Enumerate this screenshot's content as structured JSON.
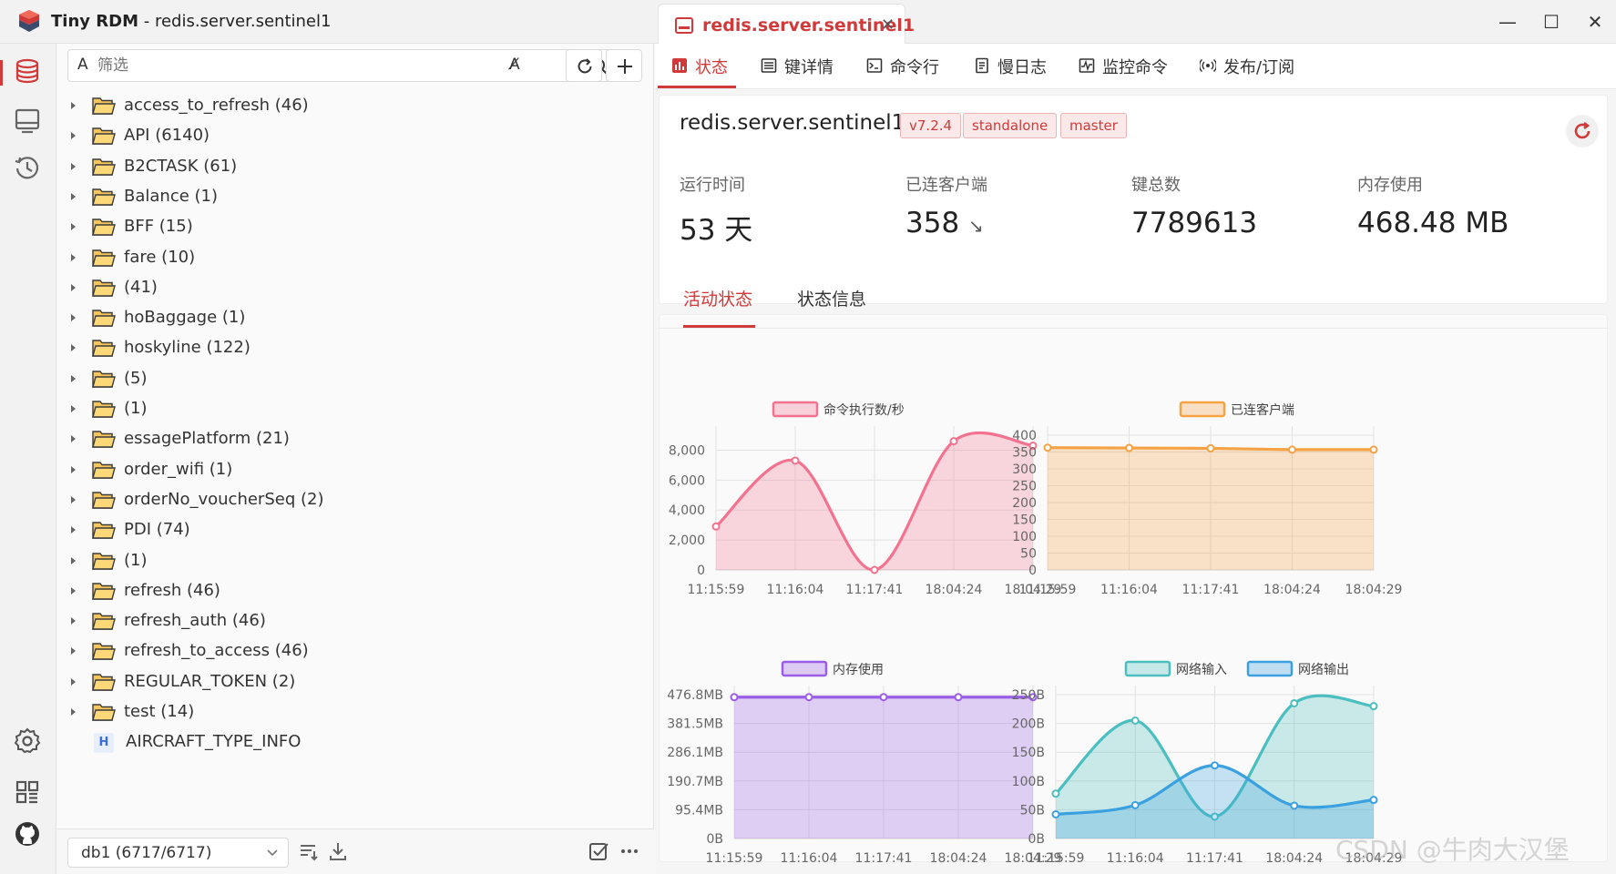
{
  "window": {
    "app_name": "Tiny RDM",
    "title_sep": " - ",
    "connection": "redis.server.sentinel1",
    "tab_label": "redis.server.sentinel1",
    "close_glyph": "✕",
    "minimize_glyph": "—",
    "maximize_glyph": "☐",
    "window_close_glyph": "✕"
  },
  "colors": {
    "accent": "#d03a3a",
    "pink": "#f3728f",
    "orange": "#f5a245",
    "purple": "#9b5de5",
    "teal": "#4bbfbf",
    "blue": "#3aa0e0"
  },
  "rail": {
    "icons": [
      "database-icon",
      "monitor-icon",
      "history-icon",
      "settings-icon",
      "grid-icon",
      "github-icon"
    ]
  },
  "browser": {
    "filter_prefix": "A",
    "filter_placeholder": "筛选",
    "case_icon_glyph": "A̸",
    "tree": [
      {
        "type": "folder",
        "label": "access_to_refresh (46)"
      },
      {
        "type": "folder",
        "label": "API (6140)"
      },
      {
        "type": "folder",
        "label": "B2CTASK (61)"
      },
      {
        "type": "folder",
        "label": "Balance (1)"
      },
      {
        "type": "folder",
        "label": "BFF (15)"
      },
      {
        "type": "folder",
        "label": "fare (10)"
      },
      {
        "type": "folder",
        "label": "(41)"
      },
      {
        "type": "folder",
        "label": "hoBaggage (1)"
      },
      {
        "type": "folder",
        "label": "hoskyline (122)"
      },
      {
        "type": "folder",
        "label": "(5)"
      },
      {
        "type": "folder",
        "label": "(1)"
      },
      {
        "type": "folder",
        "label": "essagePlatform (21)"
      },
      {
        "type": "folder",
        "label": "order_wifi (1)"
      },
      {
        "type": "folder",
        "label": "orderNo_voucherSeq (2)"
      },
      {
        "type": "folder",
        "label": "PDI (74)"
      },
      {
        "type": "folder",
        "label": "(1)"
      },
      {
        "type": "folder",
        "label": "refresh (46)"
      },
      {
        "type": "folder",
        "label": "refresh_auth (46)"
      },
      {
        "type": "folder",
        "label": "refresh_to_access (46)"
      },
      {
        "type": "folder",
        "label": "REGULAR_TOKEN (2)"
      },
      {
        "type": "folder",
        "label": "test (14)"
      },
      {
        "type": "hash",
        "badge": "H",
        "label": "AIRCRAFT_TYPE_INFO"
      }
    ],
    "db_select": "db1 (6717/6717)"
  },
  "server": {
    "tabs": [
      "状态",
      "键详情",
      "命令行",
      "慢日志",
      "监控命令",
      "发布/订阅"
    ],
    "name": "redis.server.sentinel1",
    "tags": [
      "v7.2.4",
      "standalone",
      "master"
    ],
    "stats": [
      {
        "label": "运行时间",
        "value": "53 天"
      },
      {
        "label": "已连客户端",
        "value": "358",
        "trend": "↘"
      },
      {
        "label": "键总数",
        "value": "7789613"
      },
      {
        "label": "内存使用",
        "value": "468.48 MB"
      }
    ],
    "activity_tabs": [
      "活动状态",
      "状态信息"
    ]
  },
  "chart_data": [
    {
      "type": "line",
      "title": "",
      "x": [
        "11:15:59",
        "11:16:04",
        "11:17:41",
        "18:04:24",
        "18:04:29"
      ],
      "series": [
        {
          "name": "命令执行数/秒",
          "values": [
            2900,
            7300,
            0,
            8600,
            8300
          ]
        }
      ],
      "yticks": [
        "0",
        "2,000",
        "4,000",
        "6,000",
        "8,000"
      ],
      "ylim": [
        0,
        9000
      ],
      "fill": true,
      "grid": true,
      "legend": "top-center"
    },
    {
      "type": "line",
      "title": "",
      "x": [
        "11:15:59",
        "11:16:04",
        "11:17:41",
        "18:04:24",
        "18:04:29"
      ],
      "series": [
        {
          "name": "已连客户端",
          "values": [
            363,
            362,
            361,
            357,
            357
          ]
        }
      ],
      "yticks": [
        "0",
        "50",
        "100",
        "150",
        "200",
        "250",
        "300",
        "350",
        "400"
      ],
      "ylim": [
        0,
        400
      ],
      "fill": true,
      "grid": true,
      "legend": "top-center"
    },
    {
      "type": "line",
      "title": "",
      "x": [
        "11:15:59",
        "11:16:04",
        "11:17:41",
        "18:04:24",
        "18:04:29"
      ],
      "series": [
        {
          "name": "内存使用",
          "values": [
            468.4,
            468.5,
            468.5,
            468.4,
            468.4
          ]
        }
      ],
      "yticks": [
        "0B",
        "95.4MB",
        "190.7MB",
        "286.1MB",
        "381.5MB",
        "476.8MB"
      ],
      "ylim": [
        0,
        476.8
      ],
      "fill": true,
      "grid": true,
      "legend": "top-center"
    },
    {
      "type": "line",
      "title": "",
      "x": [
        "11:15:59",
        "11:16:04",
        "11:17:41",
        "18:04:24",
        "18:04:29"
      ],
      "series": [
        {
          "name": "网络输入",
          "values": [
            78,
            205,
            38,
            235,
            230
          ]
        },
        {
          "name": "网络输出",
          "values": [
            42,
            58,
            127,
            57,
            67
          ]
        }
      ],
      "yticks": [
        "0B",
        "50B",
        "100B",
        "150B",
        "200B",
        "250B"
      ],
      "ylim": [
        0,
        250
      ],
      "fill": true,
      "grid": true,
      "legend": "top-center"
    }
  ],
  "watermark": "CSDN @牛肉大汉堡"
}
